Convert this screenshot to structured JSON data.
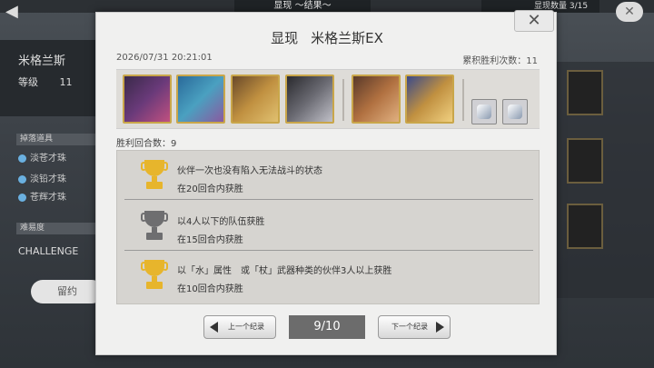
{
  "background": {
    "top_title": "显现 ～结果～",
    "top_right": "显现数量 3/15",
    "left_title": "米格兰斯",
    "left_level_label": "等级",
    "left_level_value": "11",
    "section1": "掉落道具",
    "orbs": [
      "淡苍才珠",
      "淡铅才珠",
      "苍辉才珠"
    ],
    "section2": "难易度",
    "challenge": "CHALLENGE",
    "left_button": "留约"
  },
  "modal": {
    "title_prefix": "显现",
    "title_name": "米格兰斯EX",
    "close_icon": "✕",
    "date": "2026/07/31 20:21:01",
    "cumulative_wins": "累积胜利次数：11",
    "win_rounds": "胜利回合数：9",
    "conditions": [
      {
        "text": "伙伴一次也没有陷入无法战斗的状态",
        "sub": "在20回合内获胜",
        "achieved": true
      },
      {
        "text": "以4人以下的队伍获胜",
        "sub": "在15回合内获胜",
        "achieved": false
      },
      {
        "text": "以「水」属性　或「杖」武器种类的伙伴3人以上获胜",
        "sub": "在10回合内获胜",
        "achieved": true
      }
    ],
    "nav": {
      "prev_label": "上一个纪录",
      "next_label": "下一个纪录",
      "page": "9/10"
    }
  },
  "colors": {
    "trophy_gold": "#e7b52c",
    "trophy_gray": "#6e6e70"
  }
}
